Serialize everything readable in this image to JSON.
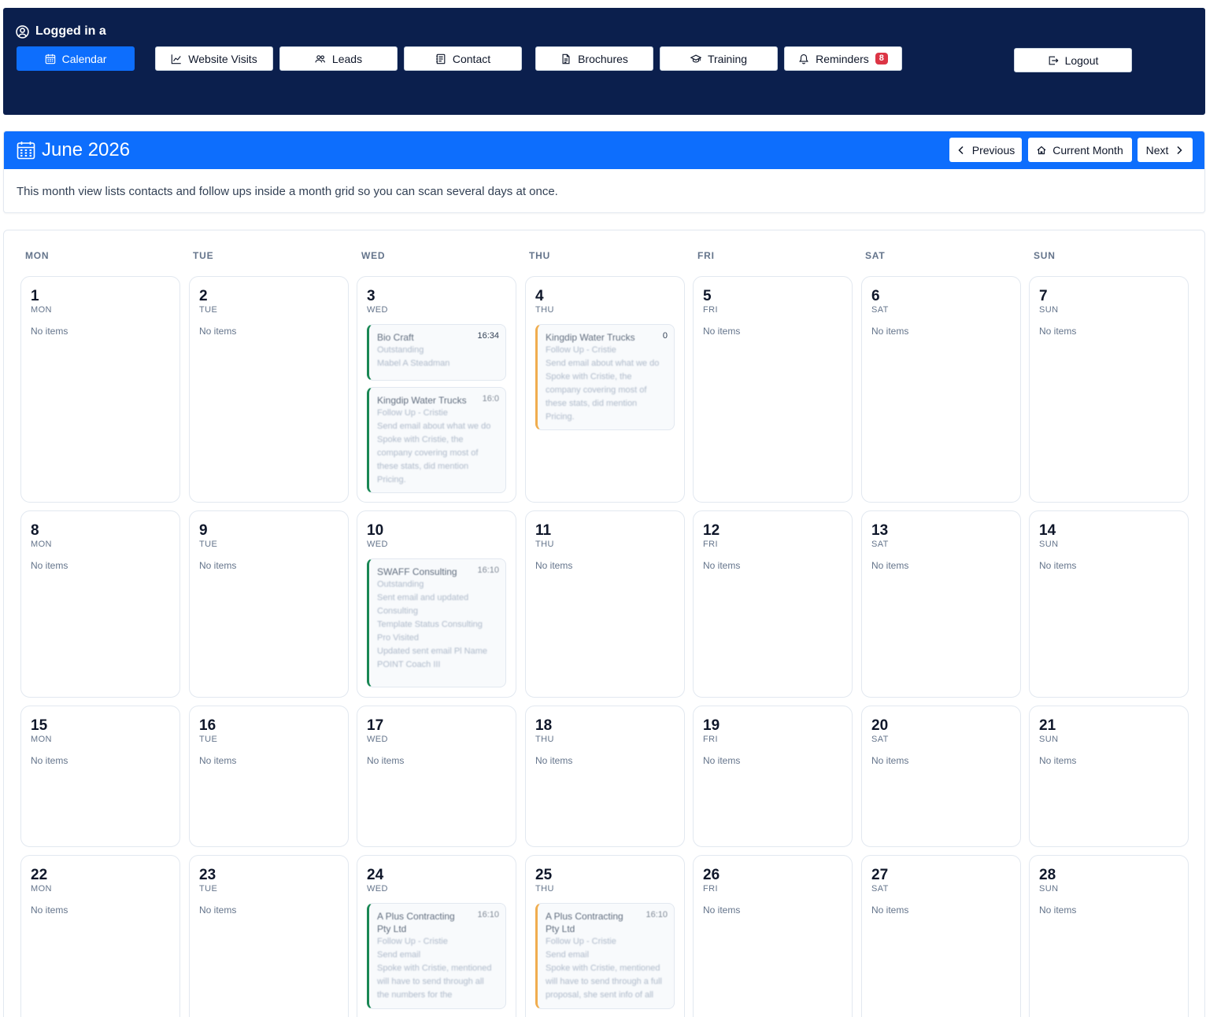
{
  "user": {
    "logged_in_label": "Logged in a"
  },
  "nav": [
    {
      "label": "Calendar",
      "icon": "calendar-icon",
      "active": true
    },
    {
      "label": "Website Visits",
      "icon": "chart-line-icon"
    },
    {
      "label": "Leads",
      "icon": "people-icon"
    },
    {
      "label": "Contact",
      "icon": "contact-icon"
    },
    {
      "label": "Brochures",
      "icon": "document-icon"
    },
    {
      "label": "Training",
      "icon": "graduation-cap-icon"
    },
    {
      "label": "Reminders",
      "icon": "bell-icon",
      "badge": "8"
    }
  ],
  "logout": {
    "label": "Logout",
    "icon": "logout-icon"
  },
  "month_header": {
    "title": "June 2026",
    "description": "This month view lists contacts and follow ups inside a month grid so you can scan several days at once.",
    "prev_label": "Previous",
    "current_label": "Current Month",
    "next_label": "Next"
  },
  "weekdays": [
    "MON",
    "TUE",
    "WED",
    "THU",
    "FRI",
    "SAT",
    "SUN"
  ],
  "empty_label": "No items",
  "days": [
    {
      "num": "1",
      "dn": "MON"
    },
    {
      "num": "2",
      "dn": "TUE"
    },
    {
      "num": "3",
      "dn": "WED",
      "items": [
        {
          "title": "Bio Craft",
          "time": "16:34",
          "accent": "green",
          "lines": [
            "Outstanding",
            "Mabel A Steadman"
          ]
        },
        {
          "title": "Kingdip Water Trucks",
          "time": "16:0",
          "time_faded": true,
          "accent": "green",
          "lines": [
            "Follow Up - Cristie",
            "Send email about what we do",
            "Spoke with Cristie, the",
            "company covering most of",
            "these stats, did mention",
            "Pricing."
          ]
        }
      ]
    },
    {
      "num": "4",
      "dn": "THU",
      "items": [
        {
          "title": "Kingdip Water Trucks",
          "time": "0",
          "accent": "orange",
          "lines": [
            "Follow Up - Cristie",
            "Send email about what we do",
            "Spoke with Cristie, the",
            "company covering most of",
            "these stats, did mention",
            "Pricing."
          ]
        }
      ]
    },
    {
      "num": "5",
      "dn": "FRI"
    },
    {
      "num": "6",
      "dn": "SAT"
    },
    {
      "num": "7",
      "dn": "SUN"
    },
    {
      "num": "8",
      "dn": "MON"
    },
    {
      "num": "9",
      "dn": "TUE"
    },
    {
      "num": "10",
      "dn": "WED",
      "items": [
        {
          "title": "SWAFF Consulting",
          "time": "16:10",
          "time_faded": true,
          "accent": "green",
          "lines": [
            "Outstanding",
            "Sent email and updated",
            "Consulting",
            "Template Status Consulting",
            "Pro Visited",
            "Updated sent email Pl Name",
            "POINT Coach III"
          ]
        }
      ]
    },
    {
      "num": "11",
      "dn": "THU"
    },
    {
      "num": "12",
      "dn": "FRI"
    },
    {
      "num": "13",
      "dn": "SAT"
    },
    {
      "num": "14",
      "dn": "SUN"
    },
    {
      "num": "15",
      "dn": "MON"
    },
    {
      "num": "16",
      "dn": "TUE"
    },
    {
      "num": "17",
      "dn": "WED"
    },
    {
      "num": "18",
      "dn": "THU"
    },
    {
      "num": "19",
      "dn": "FRI"
    },
    {
      "num": "20",
      "dn": "SAT"
    },
    {
      "num": "21",
      "dn": "SUN"
    },
    {
      "num": "22",
      "dn": "MON"
    },
    {
      "num": "23",
      "dn": "TUE"
    },
    {
      "num": "24",
      "dn": "WED",
      "items": [
        {
          "title": "A Plus Contracting Pty Ltd",
          "time": "16:10",
          "time_faded": true,
          "accent": "green",
          "lines": [
            "Follow Up - Cristie",
            "Send email",
            "Spoke with Cristie, mentioned",
            "will have to send through all",
            "the numbers for the"
          ]
        }
      ]
    },
    {
      "num": "25",
      "dn": "THU",
      "items": [
        {
          "title": "A Plus Contracting Pty Ltd",
          "time": "16:10",
          "time_faded": true,
          "accent": "orange",
          "lines": [
            "Follow Up - Cristie",
            "Send email",
            "Spoke with Cristie, mentioned",
            "will have to send through a full",
            "proposal, she sent info of all"
          ]
        }
      ]
    },
    {
      "num": "26",
      "dn": "FRI"
    },
    {
      "num": "27",
      "dn": "SAT"
    },
    {
      "num": "28",
      "dn": "SUN"
    }
  ],
  "colors": {
    "nav_bg": "#0b1f4d",
    "primary": "#0d6efd",
    "badge": "#dc3545",
    "accent_green": "#198754",
    "accent_orange": "#f0ad4e"
  }
}
